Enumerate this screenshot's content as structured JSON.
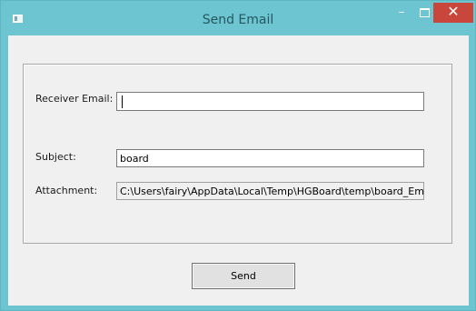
{
  "window": {
    "title": "Send Email",
    "minimize_glyph": "–",
    "close_glyph": "✕"
  },
  "form": {
    "receiver_label": "Receiver Email:",
    "receiver_value": "",
    "subject_label": "Subject:",
    "subject_value": "board",
    "attachment_label": "Attachment:",
    "attachment_value": "C:\\Users\\fairy\\AppData\\Local\\Temp\\HGBoard\\temp\\board_Email.whiteb"
  },
  "actions": {
    "send_label": "Send"
  },
  "icons": {
    "app": "app-window-icon",
    "minimize": "minimize-icon",
    "maximize": "maximize-icon",
    "close": "close-icon"
  },
  "colors": {
    "titlebar": "#6cc5d0",
    "close_button": "#c8463c",
    "client_bg": "#f0f0f0"
  }
}
